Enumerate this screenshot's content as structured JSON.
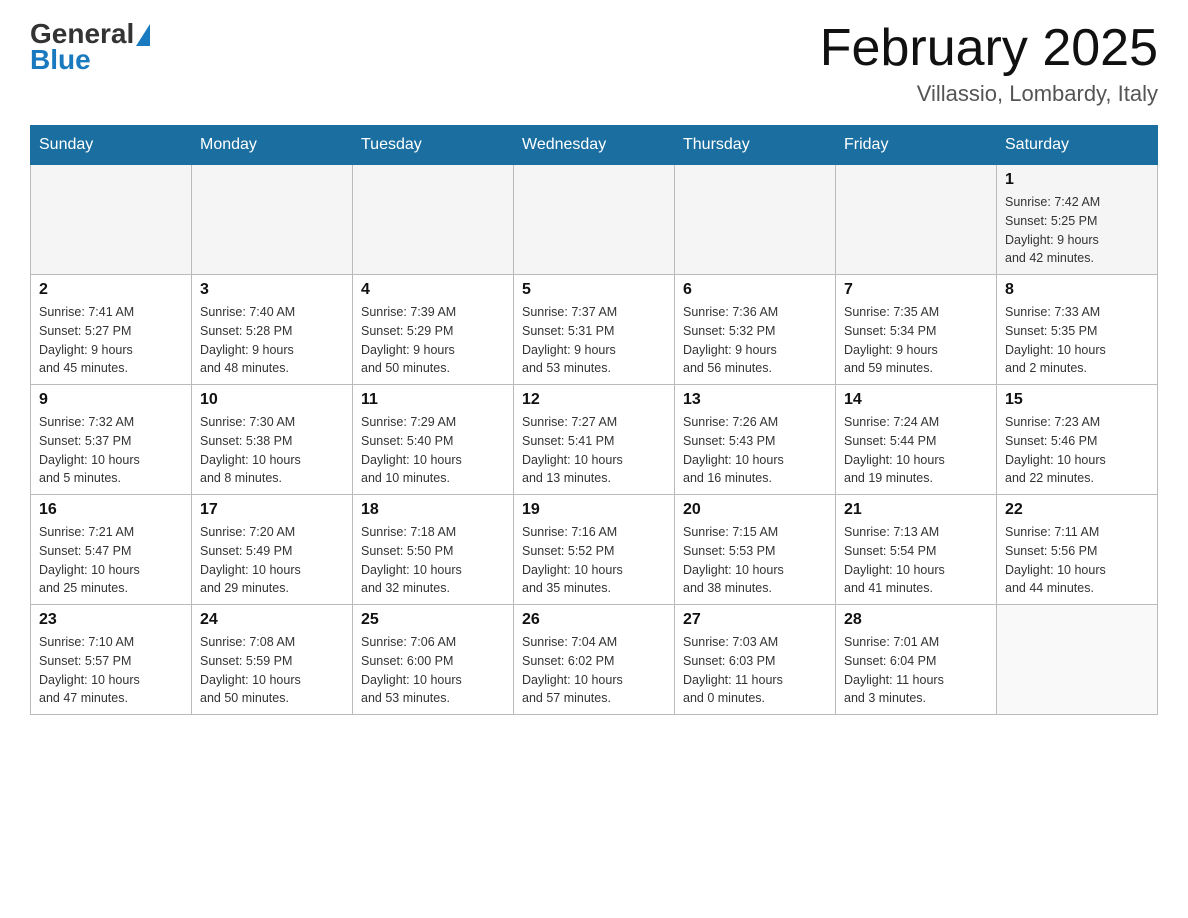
{
  "header": {
    "logo_general": "General",
    "logo_blue": "Blue",
    "month_title": "February 2025",
    "subtitle": "Villassio, Lombardy, Italy"
  },
  "days_of_week": [
    "Sunday",
    "Monday",
    "Tuesday",
    "Wednesday",
    "Thursday",
    "Friday",
    "Saturday"
  ],
  "weeks": [
    [
      {
        "day": "",
        "info": ""
      },
      {
        "day": "",
        "info": ""
      },
      {
        "day": "",
        "info": ""
      },
      {
        "day": "",
        "info": ""
      },
      {
        "day": "",
        "info": ""
      },
      {
        "day": "",
        "info": ""
      },
      {
        "day": "1",
        "info": "Sunrise: 7:42 AM\nSunset: 5:25 PM\nDaylight: 9 hours\nand 42 minutes."
      }
    ],
    [
      {
        "day": "2",
        "info": "Sunrise: 7:41 AM\nSunset: 5:27 PM\nDaylight: 9 hours\nand 45 minutes."
      },
      {
        "day": "3",
        "info": "Sunrise: 7:40 AM\nSunset: 5:28 PM\nDaylight: 9 hours\nand 48 minutes."
      },
      {
        "day": "4",
        "info": "Sunrise: 7:39 AM\nSunset: 5:29 PM\nDaylight: 9 hours\nand 50 minutes."
      },
      {
        "day": "5",
        "info": "Sunrise: 7:37 AM\nSunset: 5:31 PM\nDaylight: 9 hours\nand 53 minutes."
      },
      {
        "day": "6",
        "info": "Sunrise: 7:36 AM\nSunset: 5:32 PM\nDaylight: 9 hours\nand 56 minutes."
      },
      {
        "day": "7",
        "info": "Sunrise: 7:35 AM\nSunset: 5:34 PM\nDaylight: 9 hours\nand 59 minutes."
      },
      {
        "day": "8",
        "info": "Sunrise: 7:33 AM\nSunset: 5:35 PM\nDaylight: 10 hours\nand 2 minutes."
      }
    ],
    [
      {
        "day": "9",
        "info": "Sunrise: 7:32 AM\nSunset: 5:37 PM\nDaylight: 10 hours\nand 5 minutes."
      },
      {
        "day": "10",
        "info": "Sunrise: 7:30 AM\nSunset: 5:38 PM\nDaylight: 10 hours\nand 8 minutes."
      },
      {
        "day": "11",
        "info": "Sunrise: 7:29 AM\nSunset: 5:40 PM\nDaylight: 10 hours\nand 10 minutes."
      },
      {
        "day": "12",
        "info": "Sunrise: 7:27 AM\nSunset: 5:41 PM\nDaylight: 10 hours\nand 13 minutes."
      },
      {
        "day": "13",
        "info": "Sunrise: 7:26 AM\nSunset: 5:43 PM\nDaylight: 10 hours\nand 16 minutes."
      },
      {
        "day": "14",
        "info": "Sunrise: 7:24 AM\nSunset: 5:44 PM\nDaylight: 10 hours\nand 19 minutes."
      },
      {
        "day": "15",
        "info": "Sunrise: 7:23 AM\nSunset: 5:46 PM\nDaylight: 10 hours\nand 22 minutes."
      }
    ],
    [
      {
        "day": "16",
        "info": "Sunrise: 7:21 AM\nSunset: 5:47 PM\nDaylight: 10 hours\nand 25 minutes."
      },
      {
        "day": "17",
        "info": "Sunrise: 7:20 AM\nSunset: 5:49 PM\nDaylight: 10 hours\nand 29 minutes."
      },
      {
        "day": "18",
        "info": "Sunrise: 7:18 AM\nSunset: 5:50 PM\nDaylight: 10 hours\nand 32 minutes."
      },
      {
        "day": "19",
        "info": "Sunrise: 7:16 AM\nSunset: 5:52 PM\nDaylight: 10 hours\nand 35 minutes."
      },
      {
        "day": "20",
        "info": "Sunrise: 7:15 AM\nSunset: 5:53 PM\nDaylight: 10 hours\nand 38 minutes."
      },
      {
        "day": "21",
        "info": "Sunrise: 7:13 AM\nSunset: 5:54 PM\nDaylight: 10 hours\nand 41 minutes."
      },
      {
        "day": "22",
        "info": "Sunrise: 7:11 AM\nSunset: 5:56 PM\nDaylight: 10 hours\nand 44 minutes."
      }
    ],
    [
      {
        "day": "23",
        "info": "Sunrise: 7:10 AM\nSunset: 5:57 PM\nDaylight: 10 hours\nand 47 minutes."
      },
      {
        "day": "24",
        "info": "Sunrise: 7:08 AM\nSunset: 5:59 PM\nDaylight: 10 hours\nand 50 minutes."
      },
      {
        "day": "25",
        "info": "Sunrise: 7:06 AM\nSunset: 6:00 PM\nDaylight: 10 hours\nand 53 minutes."
      },
      {
        "day": "26",
        "info": "Sunrise: 7:04 AM\nSunset: 6:02 PM\nDaylight: 10 hours\nand 57 minutes."
      },
      {
        "day": "27",
        "info": "Sunrise: 7:03 AM\nSunset: 6:03 PM\nDaylight: 11 hours\nand 0 minutes."
      },
      {
        "day": "28",
        "info": "Sunrise: 7:01 AM\nSunset: 6:04 PM\nDaylight: 11 hours\nand 3 minutes."
      },
      {
        "day": "",
        "info": ""
      }
    ]
  ]
}
